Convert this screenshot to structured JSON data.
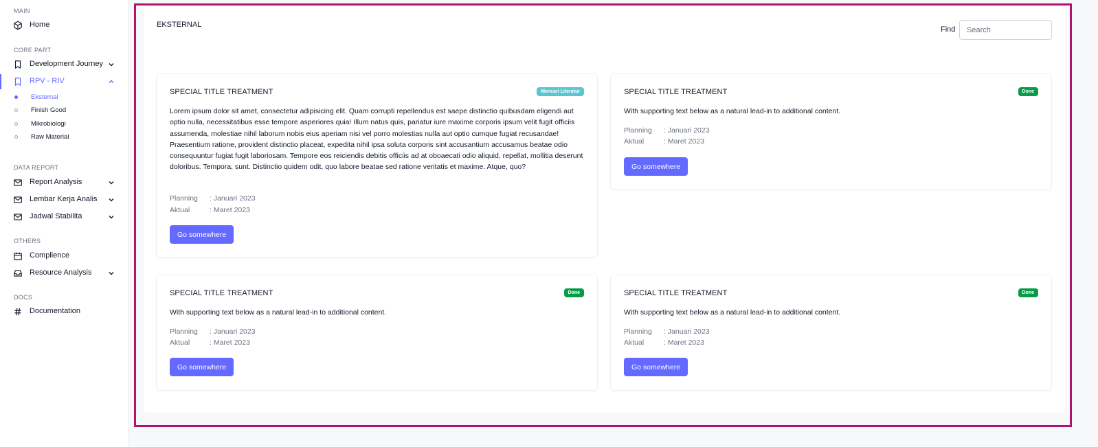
{
  "sidebar": {
    "sections": {
      "main": "MAIN",
      "core": "CORE PART",
      "data": "DATA REPORT",
      "others": "OTHERS",
      "docs": "DOCS"
    },
    "items": {
      "home": "Home",
      "dev_journey": "Development Journey",
      "rpv": "RPV - RIV",
      "report_analysis": "Report Analysis",
      "lembar_kerja": "Lembar Kerja Analis",
      "jadwal": "Jadwal Stabilita",
      "complience": "Complience",
      "resource": "Resource Analysis",
      "documentation": "Documentation"
    },
    "sub_items": [
      "Eksternal",
      "Finish Good",
      "Mikrobiologi",
      "Raw Material"
    ]
  },
  "page": {
    "title": "EKSTERNAL",
    "find_label": "Find",
    "search_placeholder": "Search"
  },
  "colors": {
    "accent": "#6469ff",
    "badge_info": "#5bc6cf",
    "badge_done": "#0a9b4a",
    "frame": "#b0136e"
  },
  "cards": [
    {
      "title": "SPECIAL TITLE TREATMENT",
      "badge": "Mencari Literatur",
      "text": "Lorem ipsum dolor sit amet, consectetur adipisicing elit. Quam corrupti repellendus est saepe distinctio quibusdam eligendi aut optio nulla, necessitatibus esse tempore asperiores quia! Illum natus quis, pariatur iure maxime corporis ipsum velit fugit officiis assumenda, molestiae nihil laborum nobis eius aperiam nisi vel porro molestias nulla aut optio cumque fugiat recusandae! Praesentium ratione, provident distinctio placeat, expedita nihil ipsa soluta corporis sint accusantium accusamus beatae odio consequuntur fugiat fugit laboriosam. Tempore eos reiciendis debitis officiis ad at oboaecati odio aliquid, repellat, mollitia deserunt doloribus. Tempora, sunt. Distinctio quidem odit, quo labore beatae sed ratione veritatis et maxime. Atque, quo?",
      "planning_label": "Planning",
      "planning_value": ": Januari 2023",
      "aktual_label": "Aktual",
      "aktual_value": ": Maret 2023",
      "button": "Go somewhere"
    },
    {
      "title": "SPECIAL TITLE TREATMENT",
      "badge": "Done",
      "text": "With supporting text below as a natural lead-in to additional content.",
      "planning_label": "Planning",
      "planning_value": ": Januari 2023",
      "aktual_label": "Aktual",
      "aktual_value": ": Maret 2023",
      "button": "Go somewhere"
    },
    {
      "title": "SPECIAL TITLE TREATMENT",
      "badge": "Done",
      "text": "With supporting text below as a natural lead-in to additional content.",
      "planning_label": "Planning",
      "planning_value": ": Januari 2023",
      "aktual_label": "Aktual",
      "aktual_value": ": Maret 2023",
      "button": "Go somewhere"
    },
    {
      "title": "SPECIAL TITLE TREATMENT",
      "badge": "Done",
      "text": "With supporting text below as a natural lead-in to additional content.",
      "planning_label": "Planning",
      "planning_value": ": Januari 2023",
      "aktual_label": "Aktual",
      "aktual_value": ": Maret 2023",
      "button": "Go somewhere"
    }
  ]
}
